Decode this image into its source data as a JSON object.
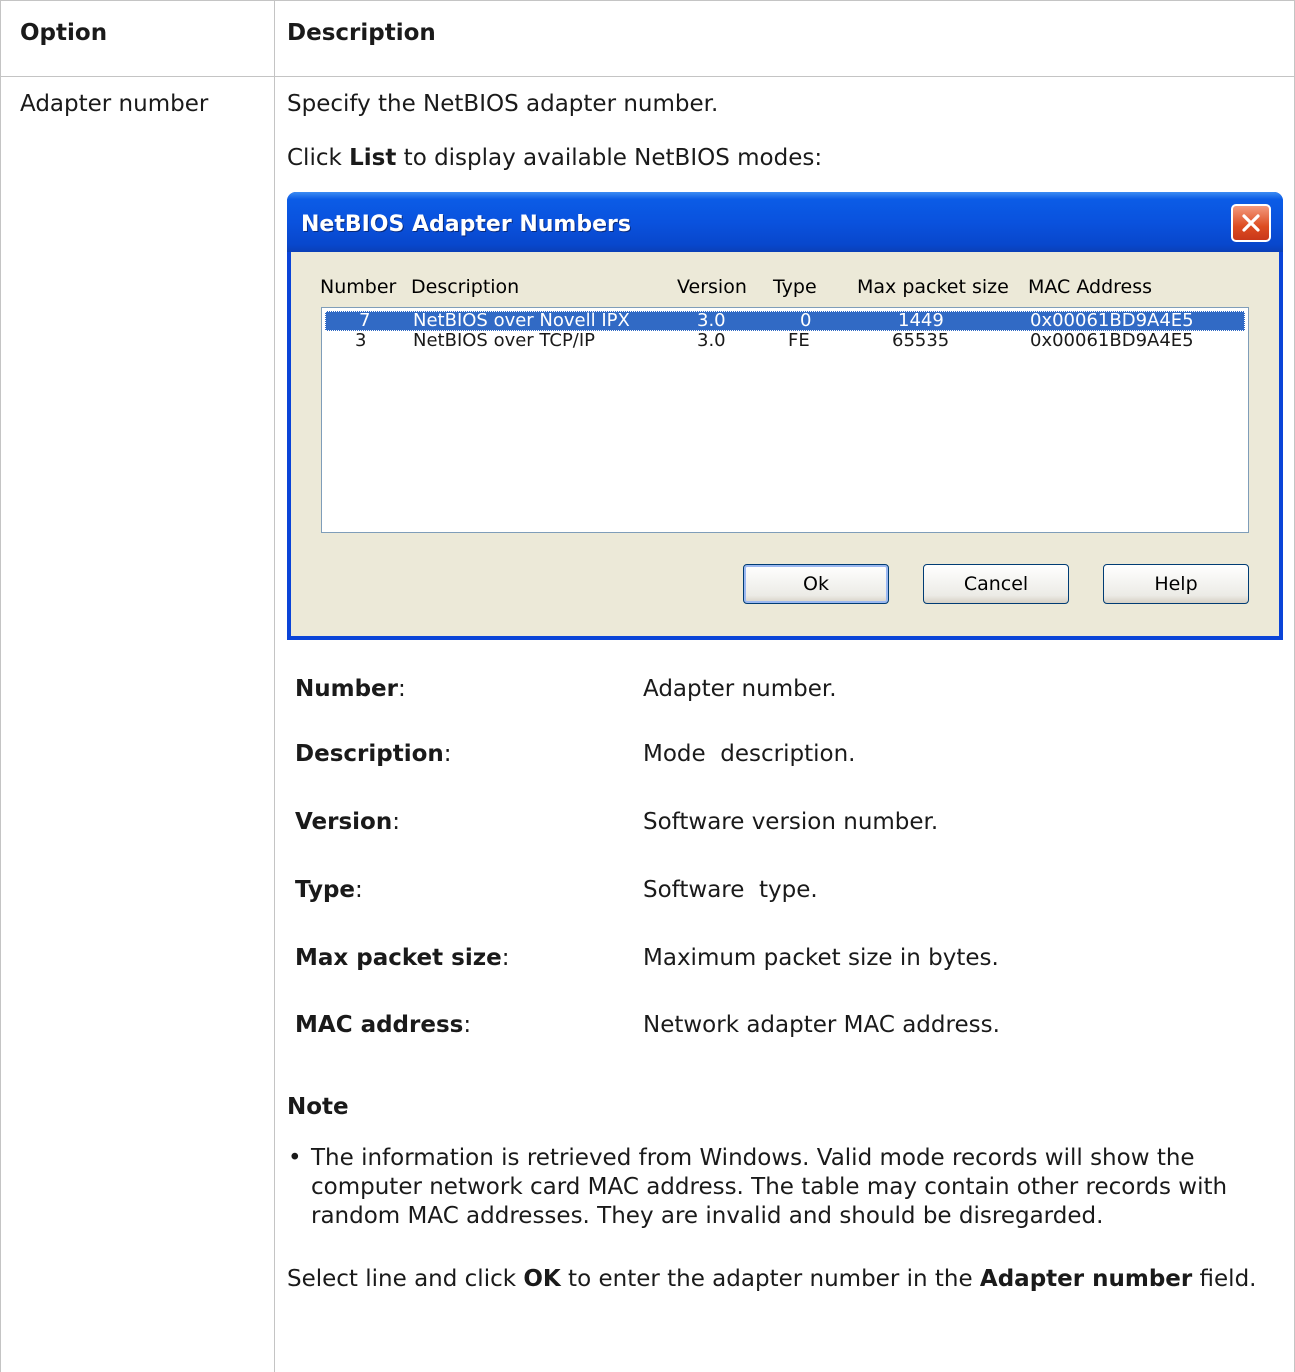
{
  "table": {
    "headers": {
      "option": "Option",
      "description": "Description"
    },
    "row": {
      "option": "Adapter number",
      "line1": "Specify the NetBIOS adapter number.",
      "line2_pre": "Click ",
      "line2_bold": "List",
      "line2_post": " to display available NetBIOS modes:"
    }
  },
  "dialog": {
    "title": "NetBIOS Adapter Numbers",
    "columns": [
      "Number",
      "Description",
      "Version",
      "Type",
      "Max packet size",
      "MAC Address"
    ],
    "rows": [
      {
        "number": "7",
        "description": "NetBIOS over Novell IPX",
        "version": "3.0",
        "type": "0",
        "max_packet": "1449",
        "mac": "0x00061BD9A4E5",
        "selected": true
      },
      {
        "number": "3",
        "description": "NetBIOS over TCP/IP",
        "version": "3.0",
        "type": "FE",
        "max_packet": "65535",
        "mac": "0x00061BD9A4E5",
        "selected": false
      }
    ],
    "buttons": {
      "ok": "Ok",
      "cancel": "Cancel",
      "help": "Help"
    }
  },
  "definitions": [
    {
      "term": "Number",
      "desc": "Adapter number."
    },
    {
      "term": "Description",
      "desc": "Mode  description."
    },
    {
      "term": "Version",
      "desc": "Software version number."
    },
    {
      "term": "Type",
      "desc": "Software  type."
    },
    {
      "term": "Max packet size",
      "desc": "Maximum packet size in bytes."
    },
    {
      "term": "MAC address",
      "desc": "Network adapter MAC address."
    }
  ],
  "note": {
    "heading": "Note",
    "bullet": "The information is retrieved from Windows. Valid mode records will show the computer network card MAC address. The table may contain other records with random MAC addresses. They are invalid and should be disregarded."
  },
  "footer": {
    "pre": "Select line and click ",
    "ok": "OK",
    "mid": " to enter the adapter number in the ",
    "field": "Adapter number",
    "post": " field."
  }
}
